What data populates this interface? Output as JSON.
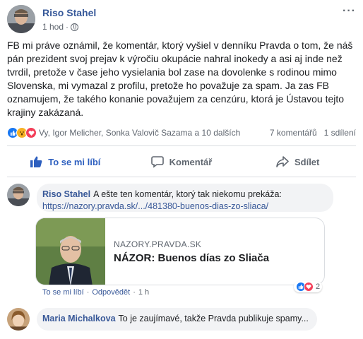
{
  "post": {
    "author": "Riso Stahel",
    "time": "1 hod",
    "separator": "·",
    "more": "···",
    "text": "FB mi práve oznámil, že komentár, ktorý vyšiel v denníku Pravda o tom, že náš pán prezident svoj prejav k výročiu okupácie nahral inokedy a asi aj inde než tvrdil, pretože v čase jeho vysielania bol zase na dovolenke s rodinou mimo Slovenska, mi vymazal z profilu, pretože ho považuje za spam. Ja zas FB oznamujem, že takého konanie považujem za cenzúru, ktorá je Ústavou tejto krajiny zakázaná."
  },
  "reactions": {
    "icons": [
      "like-icon",
      "wow-icon",
      "heart-icon"
    ],
    "names": "Vy, Igor Melicher, Sonka Valovič Sazama a 10 dalších",
    "comments": "7 komentářů",
    "shares": "1 sdílení"
  },
  "actions": {
    "like": "To se mi líbí",
    "comment": "Komentář",
    "share": "Sdílet"
  },
  "comments": [
    {
      "author": "Riso Stahel",
      "text": "A ešte ten komentár, ktorý tak niekomu prekáža:",
      "link": "https://nazory.pravda.sk/.../481380-buenos-dias-zo-sliaca/",
      "card": {
        "domain": "NAZORY.PRAVDA.SK",
        "title": "NÁZOR: Buenos días zo Sliača"
      },
      "like": "To se mi líbí",
      "reply": "Odpovědět",
      "time": "1 h",
      "reaction_count": "2"
    },
    {
      "author": "Maria Michalkova",
      "text": "To je zaujímavé, takže Pravda publikuje spamy..."
    }
  ],
  "colors": {
    "link_blue": "#385898",
    "like_blue": "#1877f2",
    "heart_red": "#f33e58",
    "wow_yellow": "#f7b125"
  }
}
